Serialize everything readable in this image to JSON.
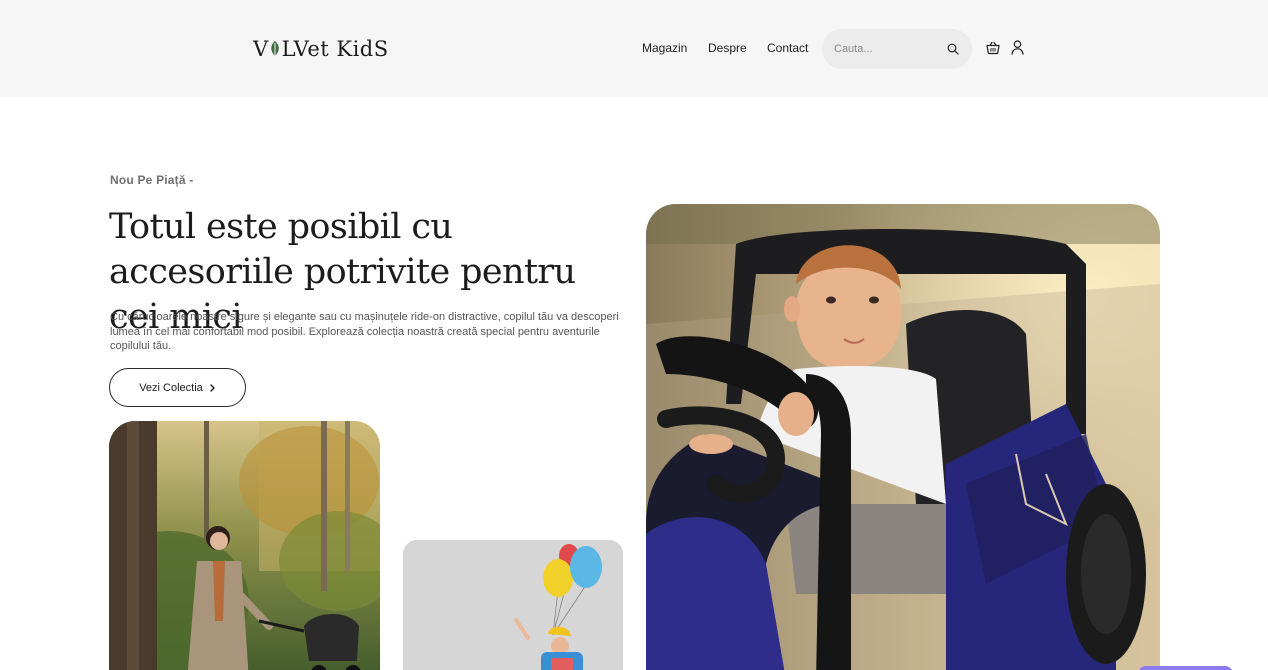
{
  "brand": {
    "name_left": "V",
    "name_right": "LVet KidS"
  },
  "nav": {
    "items": [
      {
        "label": "Magazin"
      },
      {
        "label": "Despre"
      },
      {
        "label": "Contact"
      }
    ]
  },
  "search": {
    "placeholder": "Cauta..."
  },
  "header_icons": {
    "search": "search-icon",
    "cart": "basket-icon",
    "account": "user-icon"
  },
  "hero": {
    "kicker": "Nou Pe Piață -",
    "title": "Totul este posibil cu accesoriile potrivite pentru cei mici",
    "text": "Cu cărucioarele noastre sigure și elegante sau cu mașinuțele ride-on distractive, copilul tău va descoperi lumea în cel mai confortabil mod posibil. Explorează colecția noastră creată special pentru aventurile copilului tău.",
    "cta_label": "Vezi Colectia"
  },
  "colors": {
    "header_bg": "#f6f6f6",
    "accent_leaf": "#3f6b45",
    "chat_widget": "#8d7bf1"
  }
}
